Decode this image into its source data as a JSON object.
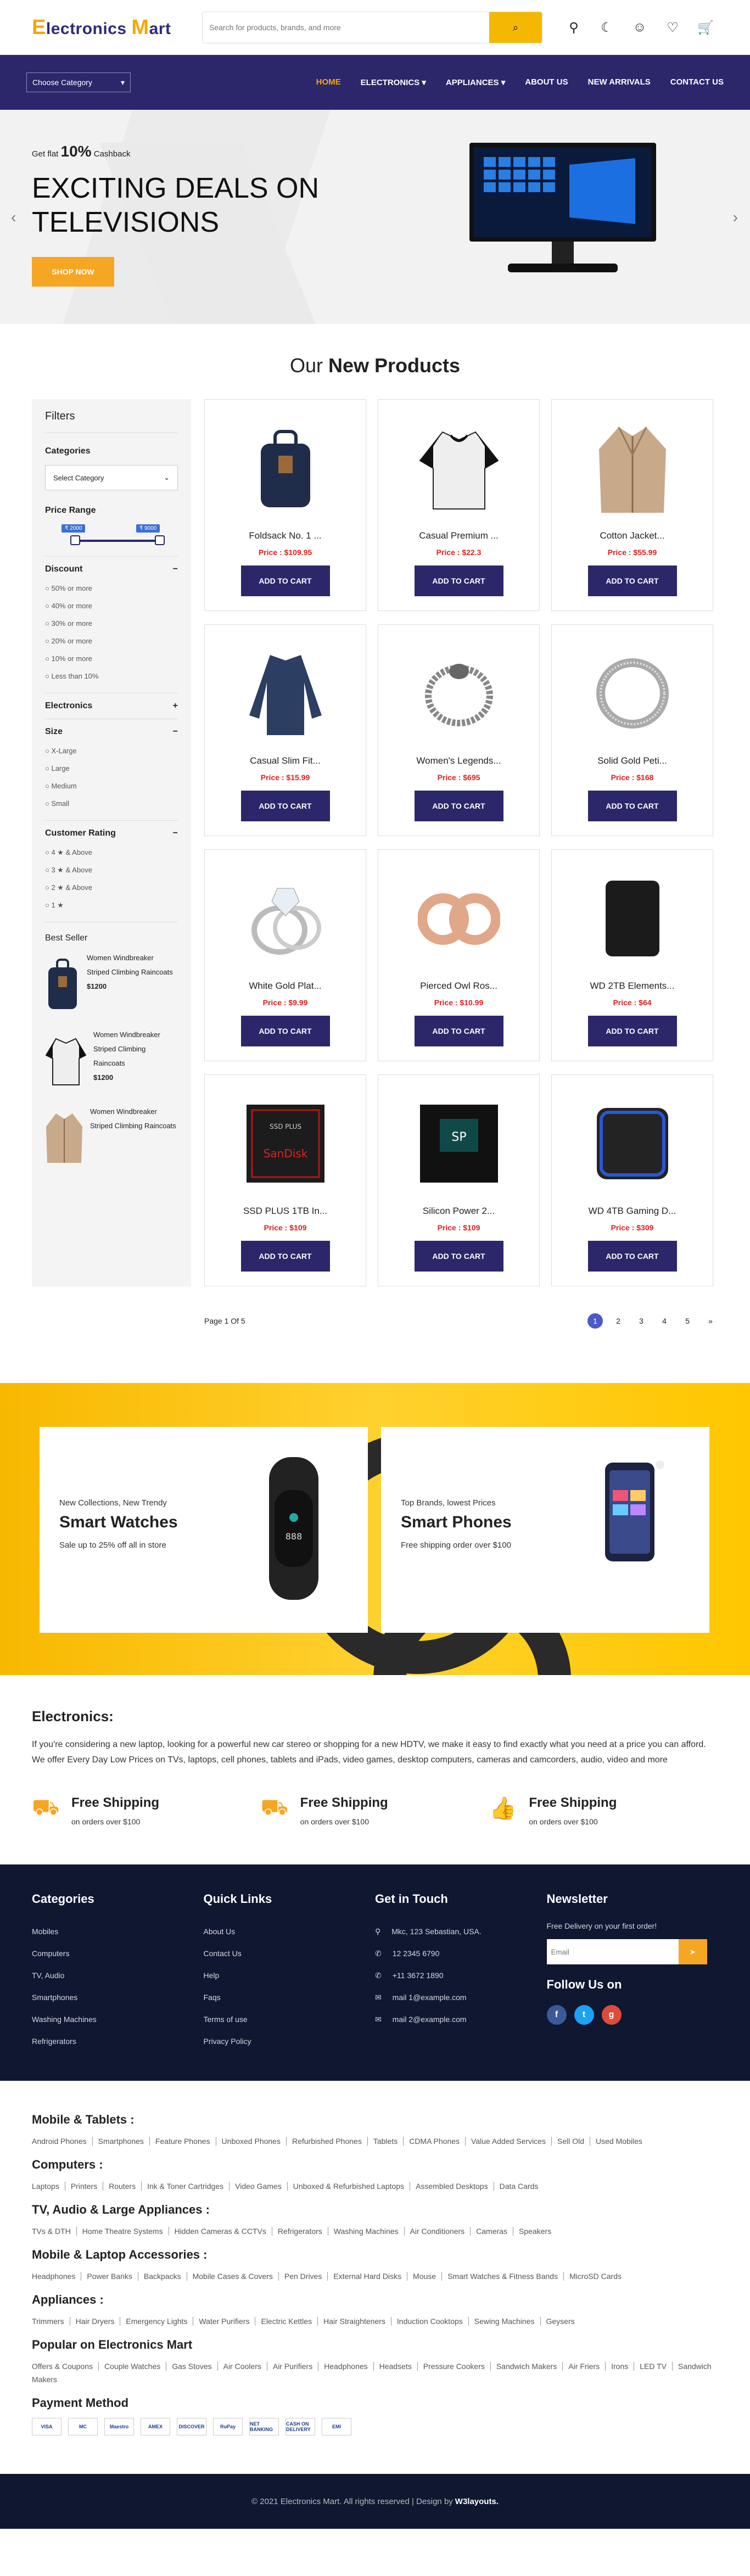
{
  "header": {
    "logo_first": "E",
    "logo_mid": "lectronics ",
    "logo_m": "M",
    "logo_last": "art",
    "search_placeholder": "Search for products, brands, and more"
  },
  "nav": {
    "category_select": "Choose Category",
    "items": [
      "HOME",
      "ELECTRONICS ▾",
      "APPLIANCES ▾",
      "ABOUT US",
      "NEW ARRIVALS",
      "CONTACT US"
    ]
  },
  "hero": {
    "cash_prefix": "Get flat",
    "cash_pct": "10%",
    "cash_suffix": "Cashback",
    "title": "EXCITING DEALS ON TELEVISIONS",
    "button": "SHOP NOW"
  },
  "products_section": {
    "title_a": "Our ",
    "title_b": "New Products"
  },
  "filters": {
    "title": "Filters",
    "categories_label": "Categories",
    "category_select": "Select Category",
    "price_label": "Price Range",
    "price_min": "₹ 2000",
    "price_max": "₹ 9000",
    "discount_label": "Discount",
    "discounts": [
      "50% or more",
      "40% or more",
      "30% or more",
      "20% or more",
      "10% or more",
      "Less than 10%"
    ],
    "electronics_label": "Electronics",
    "size_label": "Size",
    "sizes": [
      "X-Large",
      "Large",
      "Medium",
      "Small"
    ],
    "rating_label": "Customer Rating",
    "ratings": [
      "4 ★ & Above",
      "3 ★ & Above",
      "2 ★ & Above",
      "1 ★"
    ],
    "best_seller_label": "Best Seller",
    "best": [
      {
        "name": "Women Windbreaker Striped Climbing Raincoats",
        "price": "$1200"
      },
      {
        "name": "Women Windbreaker Striped Climbing Raincoats",
        "price": "$1200"
      },
      {
        "name": "Women Windbreaker Striped Climbing Raincoats",
        "price": ""
      }
    ]
  },
  "products": [
    {
      "name": "Foldsack No. 1 ...",
      "price": "Price : $109.95",
      "btn": "ADD TO CART",
      "icon": "backpack-icon"
    },
    {
      "name": "Casual Premium ...",
      "price": "Price : $22.3",
      "btn": "ADD TO CART",
      "icon": "tshirt-icon"
    },
    {
      "name": "Cotton Jacket...",
      "price": "Price : $55.99",
      "btn": "ADD TO CART",
      "icon": "jacket-icon"
    },
    {
      "name": "Casual Slim Fit...",
      "price": "Price : $15.99",
      "btn": "ADD TO CART",
      "icon": "longsleeve-icon"
    },
    {
      "name": "Women's Legends...",
      "price": "Price : $695",
      "btn": "ADD TO CART",
      "icon": "bracelet-icon"
    },
    {
      "name": "Solid Gold Peti...",
      "price": "Price : $168",
      "btn": "ADD TO CART",
      "icon": "ring-icon"
    },
    {
      "name": "White Gold Plat...",
      "price": "Price : $9.99",
      "btn": "ADD TO CART",
      "icon": "diamond-ring-icon"
    },
    {
      "name": "Pierced Owl Ros...",
      "price": "Price : $10.99",
      "btn": "ADD TO CART",
      "icon": "earrings-icon"
    },
    {
      "name": "WD 2TB Elements...",
      "price": "Price : $64",
      "btn": "ADD TO CART",
      "icon": "hard-drive-icon"
    },
    {
      "name": "SSD PLUS 1TB In...",
      "price": "Price : $109",
      "btn": "ADD TO CART",
      "icon": "ssd-icon"
    },
    {
      "name": "Silicon Power 2...",
      "price": "Price : $109",
      "btn": "ADD TO CART",
      "icon": "ssd-icon"
    },
    {
      "name": "WD 4TB Gaming D...",
      "price": "Price : $309",
      "btn": "ADD TO CART",
      "icon": "gaming-drive-icon"
    }
  ],
  "pagination": {
    "label": "Page 1 Of 5",
    "pages": [
      "1",
      "2",
      "3",
      "4",
      "5",
      "»"
    ]
  },
  "promo": [
    {
      "sub": "New Collections, New Trendy",
      "title": "Smart Watches",
      "desc": "Sale up to 25% off all in store"
    },
    {
      "sub": "Top Brands, lowest Prices",
      "title": "Smart Phones",
      "desc": "Free shipping order over $100"
    }
  ],
  "about": {
    "title": "Electronics:",
    "text": "If you're considering a new laptop, looking for a powerful new car stereo or shopping for a new HDTV, we make it easy to find exactly what you need at a price you can afford. We offer Every Day Low Prices on TVs, laptops, cell phones, tablets and iPads, video games, desktop computers, cameras and camcorders, audio, video and more"
  },
  "shipping": [
    {
      "title": "Free Shipping",
      "sub": "on orders over $100"
    },
    {
      "title": "Free Shipping",
      "sub": "on orders over $100"
    },
    {
      "title": "Free Shipping",
      "sub": "on orders over $100"
    }
  ],
  "footer": {
    "categories_title": "Categories",
    "categories": [
      "Mobiles",
      "Computers",
      "TV, Audio",
      "Smartphones",
      "Washing Machines",
      "Refrigerators"
    ],
    "links_title": "Quick Links",
    "links": [
      "About Us",
      "Contact Us",
      "Help",
      "Faqs",
      "Terms of use",
      "Privacy Policy"
    ],
    "contact_title": "Get in Touch",
    "contact": [
      "Mkc, 123 Sebastian, USA.",
      "12 2345 6790",
      "+11 3672 1890",
      "mail 1@example.com",
      "mail 2@example.com"
    ],
    "newsletter_title": "Newsletter",
    "newsletter_text": "Free Delivery on your first order!",
    "email_placeholder": "Email",
    "follow_title": "Follow Us on"
  },
  "link_groups": [
    {
      "title": "Mobile & Tablets :",
      "items": [
        "Android Phones",
        "Smartphones",
        "Feature Phones",
        "Unboxed Phones",
        "Refurbished Phones",
        "Tablets",
        "CDMA Phones",
        "Value Added Services",
        "Sell Old",
        "Used Mobiles"
      ]
    },
    {
      "title": "Computers :",
      "items": [
        "Laptops",
        "Printers",
        "Routers",
        "Ink & Toner Cartridges",
        "Video Games",
        "Unboxed & Refurbished Laptops",
        "Assembled Desktops",
        "Data Cards"
      ]
    },
    {
      "title": "TV, Audio & Large Appliances :",
      "items": [
        "TVs & DTH",
        "Home Theatre Systems",
        "Hidden Cameras & CCTVs",
        "Refrigerators",
        "Washing Machines",
        "Air Conditioners",
        "Cameras",
        "Speakers"
      ]
    },
    {
      "title": "Mobile & Laptop Accessories :",
      "items": [
        "Headphones",
        "Power Banks",
        "Backpacks",
        "Mobile Cases & Covers",
        "Pen Drives",
        "External Hard Disks",
        "Mouse",
        "Smart Watches & Fitness Bands",
        "MicroSD Cards"
      ]
    },
    {
      "title": "Appliances :",
      "items": [
        "Trimmers",
        "Hair Dryers",
        "Emergency Lights",
        "Water Purifiers",
        "Electric Kettles",
        "Hair Straighteners",
        "Induction Cooktops",
        "Sewing Machines",
        "Geysers"
      ]
    },
    {
      "title": "Popular on Electronics Mart",
      "items": [
        "Offers & Coupons",
        "Couple Watches",
        "Gas Stoves",
        "Air Coolers",
        "Air Purifiers",
        "Headphones",
        "Headsets",
        "Pressure Cookers",
        "Sandwich Makers",
        "Air Friers",
        "Irons",
        "LED TV",
        "Sandwich Makers"
      ]
    }
  ],
  "payment": {
    "title": "Payment Method",
    "methods": [
      "VISA",
      "MC",
      "Maestro",
      "AMEX",
      "DISCOVER",
      "RuPay",
      "NET BANKING",
      "CASH ON DELIVERY",
      "EMI"
    ]
  },
  "copyright": {
    "text": "© 2021 Electronics Mart. All rights reserved | Design by",
    "brand": "W3layouts."
  }
}
